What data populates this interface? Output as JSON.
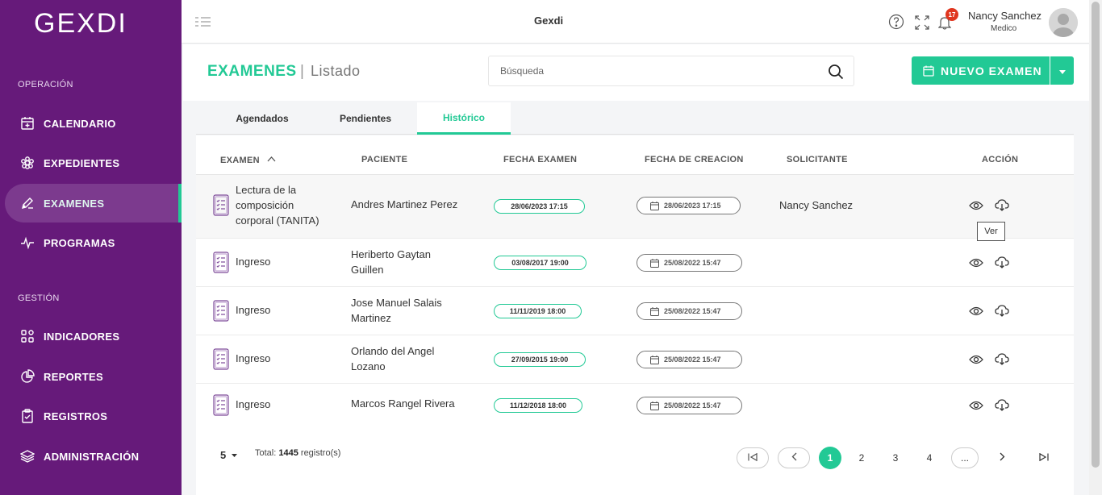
{
  "sidebar": {
    "logo": "GEXDI",
    "sections": [
      {
        "label": "OPERACIÓN"
      },
      {
        "label": "GESTIÓN"
      }
    ],
    "items": [
      {
        "label": "CALENDARIO",
        "icon": "calendar-icon"
      },
      {
        "label": "EXPEDIENTES",
        "icon": "gear-flower-icon"
      },
      {
        "label": "EXAMENES",
        "icon": "pen-icon",
        "active": true
      },
      {
        "label": "PROGRAMAS",
        "icon": "pulse-icon"
      },
      {
        "label": "INDICADORES",
        "icon": "grid-icon"
      },
      {
        "label": "REPORTES",
        "icon": "pie-chart-icon"
      },
      {
        "label": "REGISTROS",
        "icon": "clipboard-icon"
      },
      {
        "label": "ADMINISTRACIÓN",
        "icon": "layers-icon"
      }
    ]
  },
  "topbar": {
    "title": "Gexdi",
    "notifications": "17",
    "user_name": "Nancy Sanchez",
    "user_role": "Medico"
  },
  "header": {
    "title": "EXAMENES",
    "separator": "|",
    "subtitle": "Listado",
    "search_placeholder": "Búsqueda",
    "new_button": "NUEVO EXAMEN"
  },
  "tabs": [
    {
      "label": "Agendados"
    },
    {
      "label": "Pendientes"
    },
    {
      "label": "Histórico",
      "active": true
    }
  ],
  "table": {
    "columns": [
      "EXAMEN",
      "PACIENTE",
      "FECHA EXAMEN",
      "FECHA DE CREACION",
      "SOLICITANTE",
      "ACCIÓN"
    ],
    "rows": [
      {
        "exam": [
          "Lectura de la",
          "composición",
          "corporal (TANITA)"
        ],
        "patient": [
          "Andres Martinez Perez"
        ],
        "exam_date": "28/06/2023 17:15",
        "created": "28/06/2023 17:15",
        "requester": "Nancy Sanchez"
      },
      {
        "exam": [
          "Ingreso"
        ],
        "patient": [
          "Heriberto Gaytan",
          "Guillen"
        ],
        "exam_date": "03/08/2017 19:00",
        "created": "25/08/2022 15:47",
        "requester": ""
      },
      {
        "exam": [
          "Ingreso"
        ],
        "patient": [
          "Jose Manuel Salais",
          "Martinez"
        ],
        "exam_date": "11/11/2019 18:00",
        "created": "25/08/2022 15:47",
        "requester": ""
      },
      {
        "exam": [
          "Ingreso"
        ],
        "patient": [
          "Orlando del Angel",
          "Lozano"
        ],
        "exam_date": "27/09/2015 19:00",
        "created": "25/08/2022 15:47",
        "requester": ""
      },
      {
        "exam": [
          "Ingreso"
        ],
        "patient": [
          "Marcos Rangel Rivera"
        ],
        "exam_date": "11/12/2018 18:00",
        "created": "25/08/2022 15:47",
        "requester": ""
      }
    ],
    "tooltip": "Ver"
  },
  "footer": {
    "per_page": "5",
    "total_label": "Total:",
    "total_value": "1445",
    "total_suffix": "registro(s)",
    "pages": [
      "1",
      "2",
      "3",
      "4",
      "..."
    ],
    "current_page": "1"
  },
  "colors": {
    "sidebar": "#661a7a",
    "accent": "#22c995",
    "badge": "#e0361f"
  }
}
